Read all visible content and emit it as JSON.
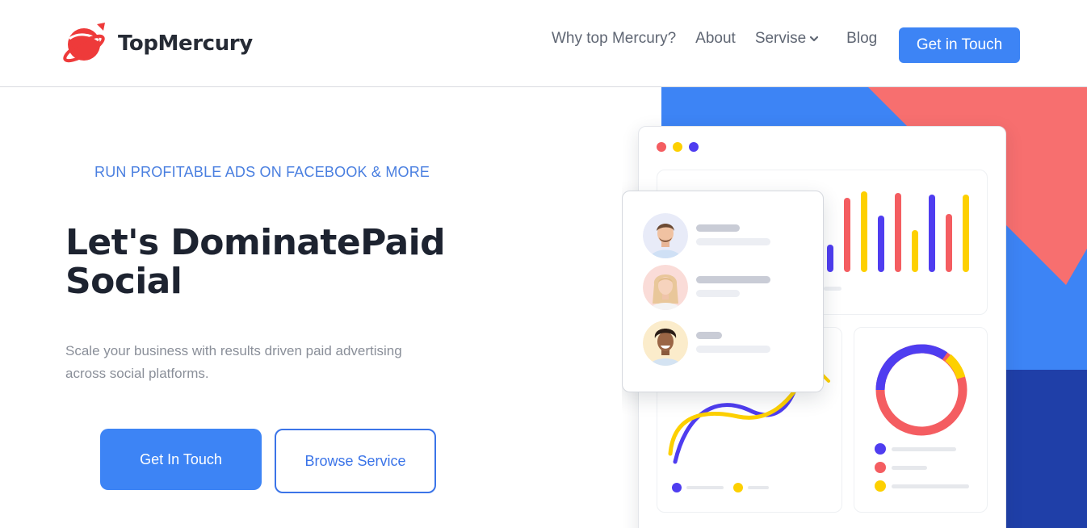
{
  "brand": {
    "name": "TopMercury"
  },
  "nav": {
    "items": [
      "Why top Mercury?",
      "About",
      "Servise",
      "Blog"
    ],
    "cta": "Get in Touch"
  },
  "hero": {
    "eyebrow": "RUN PROFITABLE ADS ON FACEBOOK & MORE",
    "headline": "Let's DominatePaid Social",
    "subtitle": "Scale your business with results driven paid advertising across social platforms.",
    "primary_button": "Get In Touch",
    "secondary_button": "Browse Service"
  },
  "colors": {
    "accent": "#3d84f5",
    "illustration_blue": "#3d84f5",
    "illustration_dark_blue": "#1f3fa8",
    "illustration_coral": "#f76f6f",
    "chart_purple": "#4f3df0",
    "chart_red": "#f45d61",
    "chart_yellow": "#fdd000"
  },
  "icons": [
    "logo-planet-icon",
    "chevron-down-icon"
  ]
}
